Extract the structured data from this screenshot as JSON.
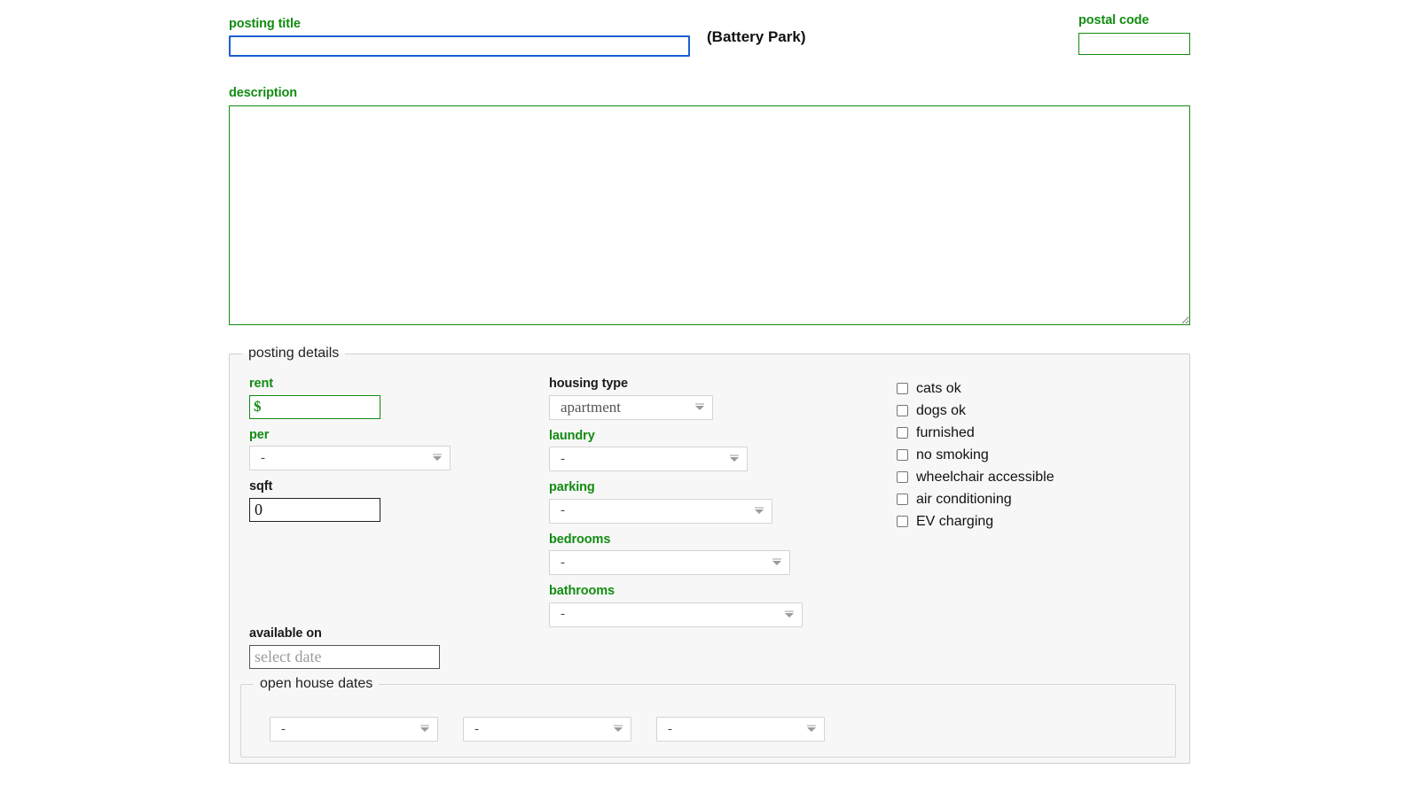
{
  "form": {
    "posting_title": {
      "label": "posting title",
      "value": "",
      "neighborhood": "(Battery Park)"
    },
    "postal_code": {
      "label": "postal code",
      "value": ""
    },
    "description": {
      "label": "description",
      "value": ""
    },
    "posting_details": {
      "legend": "posting details",
      "rent": {
        "label": "rent",
        "value": "$"
      },
      "per": {
        "label": "per",
        "value": "-"
      },
      "sqft": {
        "label": "sqft",
        "value": "0"
      },
      "housing_type": {
        "label": "housing type",
        "value": "apartment"
      },
      "laundry": {
        "label": "laundry",
        "value": "-"
      },
      "parking": {
        "label": "parking",
        "value": "-"
      },
      "bedrooms": {
        "label": "bedrooms",
        "value": "-"
      },
      "bathrooms": {
        "label": "bathrooms",
        "value": "-"
      },
      "amenities": [
        {
          "label": "cats ok",
          "checked": false
        },
        {
          "label": "dogs ok",
          "checked": false
        },
        {
          "label": "furnished",
          "checked": false
        },
        {
          "label": "no smoking",
          "checked": false
        },
        {
          "label": "wheelchair accessible",
          "checked": false
        },
        {
          "label": "air conditioning",
          "checked": false
        },
        {
          "label": "EV charging",
          "checked": false
        }
      ],
      "available_on": {
        "label": "available on",
        "placeholder": "select date",
        "value": ""
      },
      "open_house_dates": {
        "legend": "open house dates",
        "slots": [
          {
            "value": "-"
          },
          {
            "value": "-"
          },
          {
            "value": "-"
          }
        ]
      }
    }
  },
  "colors": {
    "required_green": "#128c12",
    "focus_blue": "#1b5fd0",
    "text_black": "#111111",
    "panel_bg": "#f7f7f7",
    "panel_border": "#cfcfcf"
  },
  "icons": {
    "chevron_down": "chevron-down-icon",
    "resize_handle": "resize-handle-icon"
  }
}
